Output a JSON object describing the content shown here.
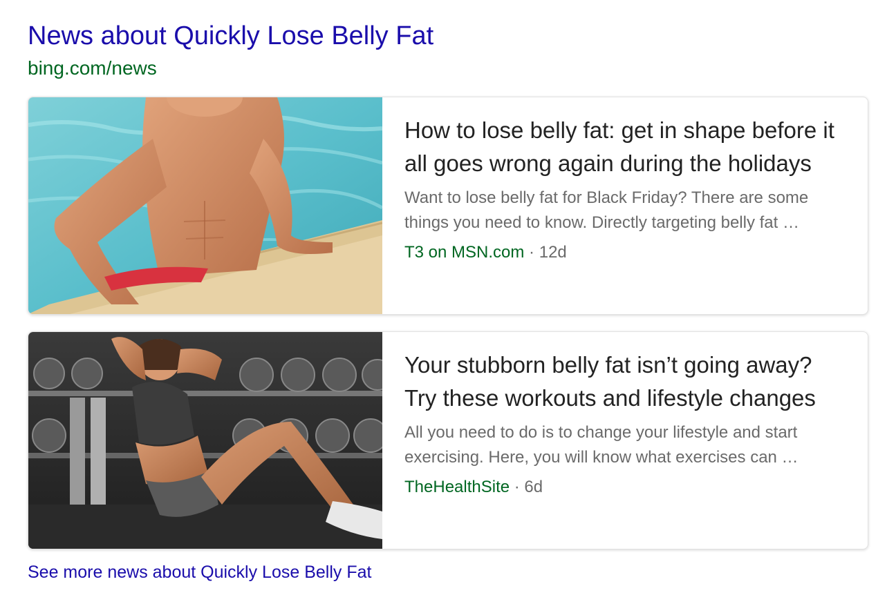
{
  "header": {
    "title": "News about Quickly Lose Belly Fat",
    "url": "bing.com/news"
  },
  "articles": [
    {
      "headline": "How to lose belly fat: get in shape before it all goes wrong again during the holidays",
      "snippet": "Want to lose belly fat for Black Friday? There are some things you need to know. Directly targeting belly fat …",
      "source": "T3 on MSN.com",
      "separator": " · ",
      "age": "12d",
      "thumbnail": "man-in-swimming-pool-image"
    },
    {
      "headline": "Your stubborn belly fat isn’t going away? Try these workouts and lifestyle changes",
      "snippet": "All you need to do is to change your lifestyle and start exercising. Here, you will know what exercises can …",
      "source": "TheHealthSite",
      "separator": " · ",
      "age": "6d",
      "thumbnail": "woman-doing-crunches-in-gym-image"
    }
  ],
  "see_more": "See more news about Quickly Lose Belly Fat",
  "colors": {
    "link": "#1a0dab",
    "url_green": "#006621",
    "headline_text": "#222222",
    "snippet_text": "#6a6a6a"
  }
}
